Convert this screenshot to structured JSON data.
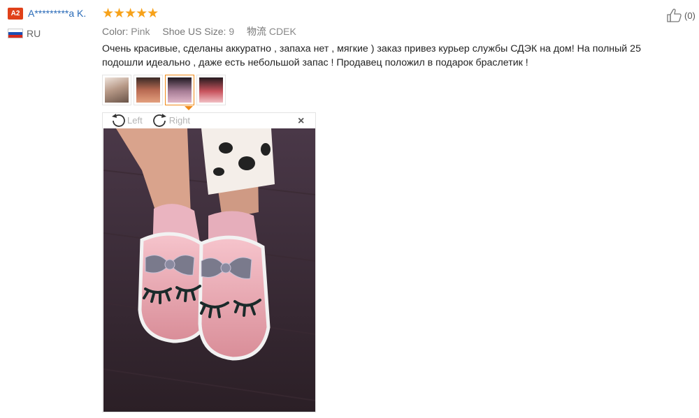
{
  "reviewer": {
    "level_badge": "A2",
    "name": "A*********a K.",
    "country": "RU",
    "flag_colors": [
      "#ffffff",
      "#1a4fb5",
      "#d52b1e"
    ]
  },
  "rating": {
    "stars": 5,
    "stars_text": "★★★★★",
    "color": "#f7a21a"
  },
  "attributes": {
    "color_label": "Color:",
    "color_value": "Pink",
    "size_label": "Shoe US Size:",
    "size_value": "9",
    "shipping_label": "物流",
    "shipping_value": "CDEK"
  },
  "review_text": "Очень красивые, сделаны аккуратно , запаха нет , мягкие ) заказ привез курьер службы СДЭК на дом! На полный 25 подошли идеально , даже есть небольшой запас ! Продавец положил в подарок браслетик !",
  "helpful": {
    "count_text": "(0)"
  },
  "viewer": {
    "rotate_left_label": "Left",
    "rotate_right_label": "Right",
    "close_symbol": "×",
    "selected_thumb_index": 2
  },
  "colors": {
    "accent": "#f08a18",
    "link": "#2a6bb8"
  }
}
